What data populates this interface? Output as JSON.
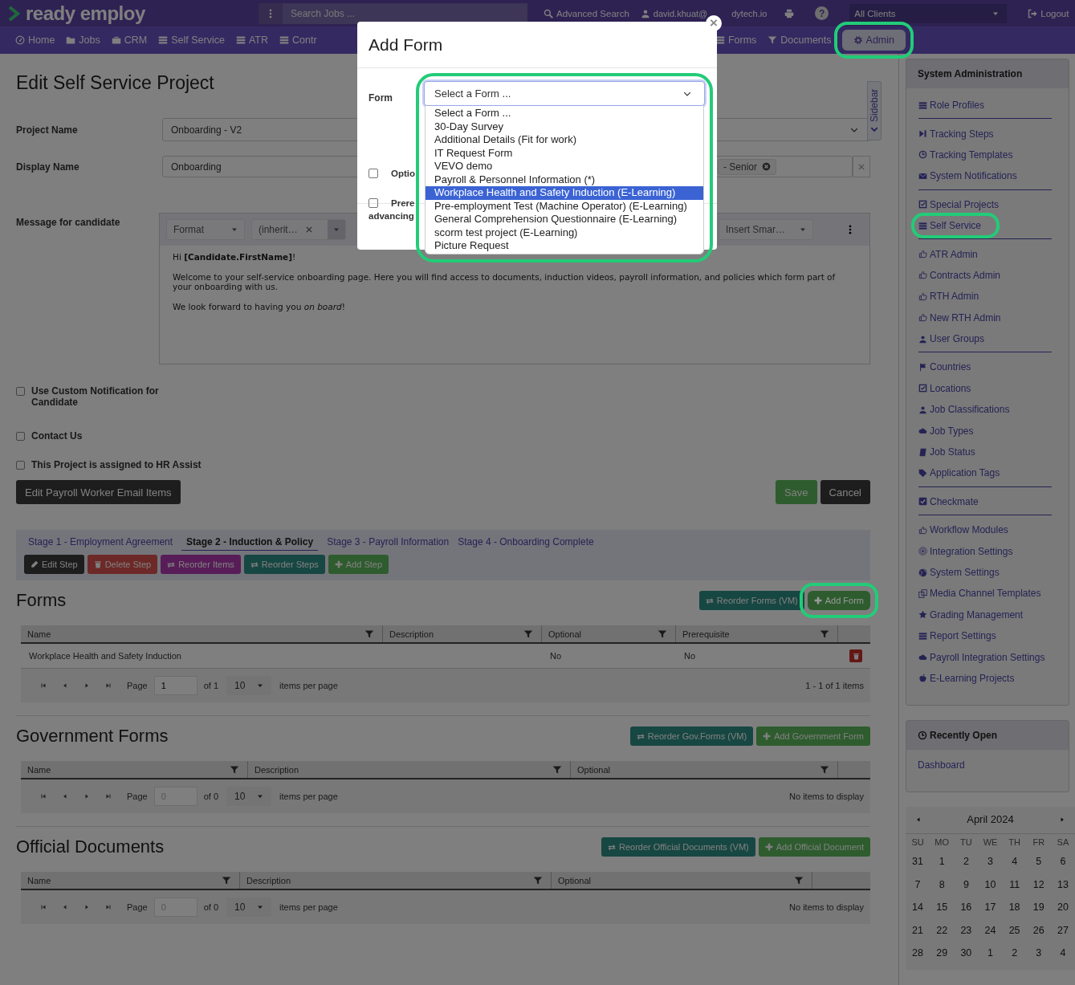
{
  "topbar": {
    "logo": "ready employ",
    "search": {
      "placeholder": "Search Jobs ..."
    },
    "advanced_search": "Advanced Search",
    "user_start": "david.khuat@",
    "user_end": "dytech.io",
    "help": "?",
    "client_select": "All Clients",
    "logout": "Logout"
  },
  "nav": {
    "items": [
      {
        "label": "Home",
        "selected": false,
        "highlighted": false
      },
      {
        "label": "Jobs",
        "selected": false,
        "highlighted": false
      },
      {
        "label": "CRM",
        "selected": false,
        "highlighted": false
      },
      {
        "label": "Self Service",
        "selected": false,
        "highlighted": false
      },
      {
        "label": "ATR",
        "selected": false,
        "highlighted": false
      },
      {
        "label": "Contr",
        "selected": false,
        "highlighted": false
      },
      {
        "label": "Forms",
        "selected": false,
        "highlighted": false
      },
      {
        "label": "Documents",
        "selected": false,
        "highlighted": false
      },
      {
        "label": "Admin",
        "selected": true,
        "highlighted": true
      }
    ]
  },
  "page": {
    "title": "Edit Self Service Project",
    "project_name": {
      "label": "Project Name",
      "value": "Onboarding - V2"
    },
    "display_name": {
      "label": "Display Name",
      "value": "Onboarding",
      "tags": [
        "- Senior"
      ]
    },
    "message": {
      "label": "Message for candidate",
      "format": "Format",
      "font": "(inherit…",
      "smart": "Insert Smar…",
      "paragraphs": [
        "Hi **[Candidate.FirstName]**!",
        "Welcome to your self-service onboarding page. Here you will find access to documents, induction videos, payroll information, and policies which form part of your onboarding with us.",
        "We look forward to having you *on board*!"
      ]
    },
    "checkboxes": [
      {
        "label": "Use Custom Notification for Candidate",
        "checked": false
      },
      {
        "label": "Contact Us",
        "checked": false
      },
      {
        "label": "This Project is assigned to HR Assist",
        "checked": false
      }
    ],
    "edit_payroll": "Edit Payroll Worker Email Items",
    "save": "Save",
    "cancel": "Cancel"
  },
  "stages": {
    "tabs": [
      {
        "label": "Stage 1 - Employment Agreement",
        "selected": false
      },
      {
        "label": "Stage 2 - Induction & Policy",
        "selected": true
      },
      {
        "label": "Stage 3 - Payroll Information",
        "selected": false
      },
      {
        "label": "Stage 4 - Onboarding Complete",
        "selected": false
      }
    ],
    "buttons": [
      {
        "label": "Edit Step",
        "kind": "dark"
      },
      {
        "label": "Delete Step",
        "kind": "danger"
      },
      {
        "label": "Reorder Items",
        "kind": "purple"
      },
      {
        "label": "Reorder Steps",
        "kind": "teal"
      },
      {
        "label": "Add Step",
        "kind": "success"
      }
    ]
  },
  "sections": [
    {
      "title": "Forms",
      "buttons": [
        {
          "label": "Reorder Forms (VM)",
          "kind": "teal",
          "highlighted": false
        },
        {
          "label": "Add Form",
          "kind": "success",
          "highlighted": true
        }
      ],
      "columns": [
        "Name",
        "Description",
        "Optional",
        "Prerequisite"
      ],
      "rows": [
        {
          "name": "Workplace Health and Safety Induction",
          "optional": "No",
          "prerequisite": "No"
        }
      ],
      "pager": {
        "page_label": "Page",
        "page": "1",
        "page_disabled": false,
        "of": "of 1",
        "per_page": "10",
        "per_page_label": "items per page",
        "summary": "1 - 1 of 1 items"
      }
    },
    {
      "title": "Government Forms",
      "buttons": [
        {
          "label": "Reorder Gov.Forms (VM)",
          "kind": "teal",
          "highlighted": false
        },
        {
          "label": "Add Government Form",
          "kind": "success",
          "highlighted": false
        }
      ],
      "columns": [
        "Name",
        "Description",
        "Optional"
      ],
      "pager": {
        "page_label": "Page",
        "page": "0",
        "page_disabled": true,
        "of": "of 0",
        "per_page": "10",
        "per_page_label": "items per page",
        "summary": "No items to display"
      }
    },
    {
      "title": "Official Documents",
      "buttons": [
        {
          "label": "Reorder Official Documents (VM)",
          "kind": "teal",
          "highlighted": false
        },
        {
          "label": "Add Official Document",
          "kind": "success",
          "highlighted": false
        }
      ],
      "columns": [
        "Name",
        "Description",
        "Optional"
      ],
      "pager": {
        "page_label": "Page",
        "page": "0",
        "page_disabled": true,
        "of": "of 0",
        "per_page": "10",
        "per_page_label": "items per page",
        "summary": "No items to display"
      }
    }
  ],
  "sidebar": {
    "tab": "Sidebar",
    "admin": {
      "title": "System Administration",
      "groups": [
        [
          {
            "label": "Role Profiles",
            "highlighted": false
          }
        ],
        [
          {
            "label": "Tracking Steps",
            "highlighted": false
          },
          {
            "label": "Tracking Templates",
            "highlighted": false
          },
          {
            "label": "System Notifications",
            "highlighted": false
          }
        ],
        [
          {
            "label": "Special Projects",
            "highlighted": false
          },
          {
            "label": "Self Service",
            "highlighted": true
          }
        ],
        [
          {
            "label": "ATR Admin",
            "highlighted": false
          },
          {
            "label": "Contracts Admin",
            "highlighted": false
          },
          {
            "label": "RTH Admin",
            "highlighted": false
          },
          {
            "label": "New RTH Admin",
            "highlighted": false
          },
          {
            "label": "User Groups",
            "highlighted": false
          }
        ],
        [
          {
            "label": "Countries",
            "highlighted": false
          },
          {
            "label": "Locations",
            "highlighted": false
          },
          {
            "label": "Job Classifications",
            "highlighted": false
          },
          {
            "label": "Job Types",
            "highlighted": false
          },
          {
            "label": "Job Status",
            "highlighted": false
          },
          {
            "label": "Application Tags",
            "highlighted": false
          }
        ],
        [
          {
            "label": "Checkmate",
            "highlighted": false
          }
        ],
        [
          {
            "label": "Workflow Modules",
            "highlighted": false
          },
          {
            "label": "Integration Settings",
            "highlighted": false
          },
          {
            "label": "System Settings",
            "highlighted": false
          },
          {
            "label": "Media Channel Templates",
            "highlighted": false
          },
          {
            "label": "Grading Management",
            "highlighted": false
          },
          {
            "label": "Report Settings",
            "highlighted": false
          },
          {
            "label": "Payroll Integration Settings",
            "highlighted": false
          },
          {
            "label": "E-Learning Projects",
            "highlighted": false
          }
        ]
      ]
    },
    "recent": {
      "title": "Recently Open",
      "items": [
        "Dashboard"
      ]
    },
    "calendar": {
      "month": "April 2024",
      "days": [
        "SU",
        "MO",
        "TU",
        "WE",
        "TH",
        "FR",
        "SA"
      ],
      "weeks": [
        [
          "31",
          "1",
          "2",
          "3",
          "4",
          "5",
          "6"
        ],
        [
          "7",
          "8",
          "9",
          "10",
          "11",
          "12",
          "13"
        ],
        [
          "14",
          "15",
          "16",
          "17",
          "18",
          "19",
          "20"
        ],
        [
          "21",
          "22",
          "23",
          "24",
          "25",
          "26",
          "27"
        ],
        [
          "28",
          "29",
          "30",
          "1",
          "2",
          "3",
          "4"
        ]
      ]
    }
  },
  "modal": {
    "title": "Add Form",
    "close": "×",
    "form_label": "Form",
    "select": {
      "value": "Select a Form ...",
      "highlighted": true
    },
    "options": [
      {
        "label": "Select a Form ...",
        "selected": false
      },
      {
        "label": "30-Day Survey",
        "selected": false
      },
      {
        "label": "Additional Details (Fit for work)",
        "selected": false
      },
      {
        "label": "IT Request Form",
        "selected": false
      },
      {
        "label": "VEVO demo",
        "selected": false
      },
      {
        "label": "Payroll & Personnel Information (*)",
        "selected": false
      },
      {
        "label": "Workplace Health and Safety Induction (E-Learning)",
        "selected": true
      },
      {
        "label": "Pre-employment Test (Machine Operator) (E-Learning)",
        "selected": false
      },
      {
        "label": "General Comprehension Questionnaire (E-Learning)",
        "selected": false
      },
      {
        "label": "scorm test project (E-Learning)",
        "selected": false
      },
      {
        "label": "Picture Request",
        "selected": false
      }
    ],
    "checks": [
      {
        "lines": [
          "Optio"
        ],
        "checked": false
      },
      {
        "lines": [
          "Prere",
          "advancing"
        ],
        "checked": false
      }
    ]
  }
}
